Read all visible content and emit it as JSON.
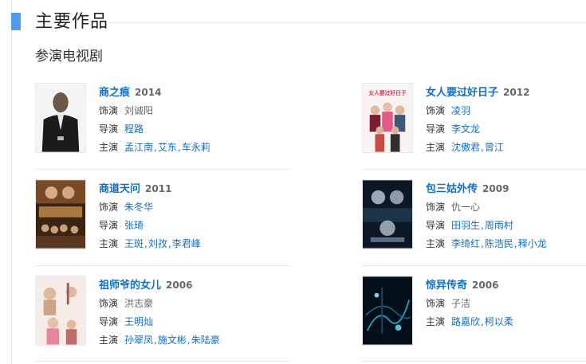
{
  "section": {
    "title": "主要作品",
    "subtitle": "参演电视剧"
  },
  "colors": {
    "accent": "#4f9cee",
    "link": "#136ec2"
  },
  "labels": {
    "role": "饰演",
    "director": "导演",
    "starring": "主演"
  },
  "works": [
    {
      "title": "商之痕",
      "year": "2014",
      "role": "刘诚阳",
      "director": [
        "程路"
      ],
      "starring": [
        "孟江南",
        "艾东",
        "车永莉"
      ]
    },
    {
      "title": "女人要过好日子",
      "year": "2012",
      "role": "凌羽",
      "director": [
        "李文龙"
      ],
      "starring": [
        "沈傲君",
        "曾江"
      ],
      "poster_text": "女人要过好日子"
    },
    {
      "title": "商道天问",
      "year": "2011",
      "role": "朱冬华",
      "director": [
        "张琦"
      ],
      "starring": [
        "王斑",
        "刘孜",
        "李君峰"
      ]
    },
    {
      "title": "包三姑外传",
      "year": "2009",
      "role": "仇一心",
      "director": [
        "田羽生",
        "周雨村"
      ],
      "starring": [
        "李绮红",
        "陈浩民",
        "释小龙"
      ]
    },
    {
      "title": "祖师爷的女儿",
      "year": "2006",
      "role": "洪志豪",
      "director": [
        "王明灿"
      ],
      "starring": [
        "孙翠凤",
        "施文彬",
        "朱陆豪"
      ]
    },
    {
      "title": "惊异传奇",
      "year": "2006",
      "role": "子洁",
      "director": [],
      "starring": [
        "路嘉欣",
        "柯以柔"
      ]
    }
  ]
}
